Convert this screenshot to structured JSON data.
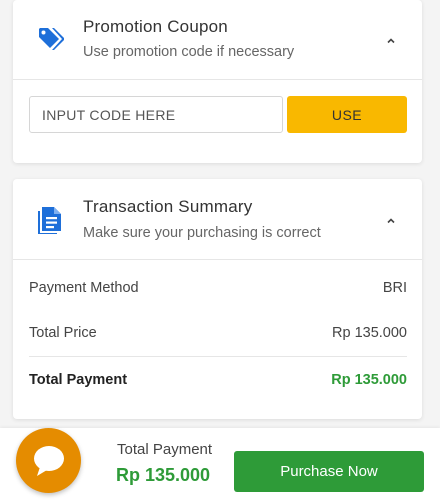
{
  "coupon": {
    "title": "Promotion Coupon",
    "subtitle": "Use promotion code if necessary",
    "input_placeholder": "INPUT CODE HERE",
    "input_value": "",
    "use_label": "USE",
    "icon": "tag-icon"
  },
  "summary": {
    "title": "Transaction Summary",
    "subtitle": "Make sure your purchasing is correct",
    "icon": "document-icon",
    "rows": [
      {
        "label": "Payment Method",
        "value": "BRI"
      },
      {
        "label": "Total Price",
        "value": "Rp 135.000"
      }
    ],
    "total": {
      "label": "Total Payment",
      "value": "Rp 135.000"
    }
  },
  "footer": {
    "total_label": "Total Payment",
    "total_value": "Rp 135.000",
    "purchase_label": "Purchase Now",
    "chat_icon": "chat-bubble-icon"
  },
  "colors": {
    "accent_blue": "#1e6fd9",
    "button_yellow": "#f9b800",
    "success_green": "#2e9b38",
    "chat_orange": "#e58c00"
  }
}
